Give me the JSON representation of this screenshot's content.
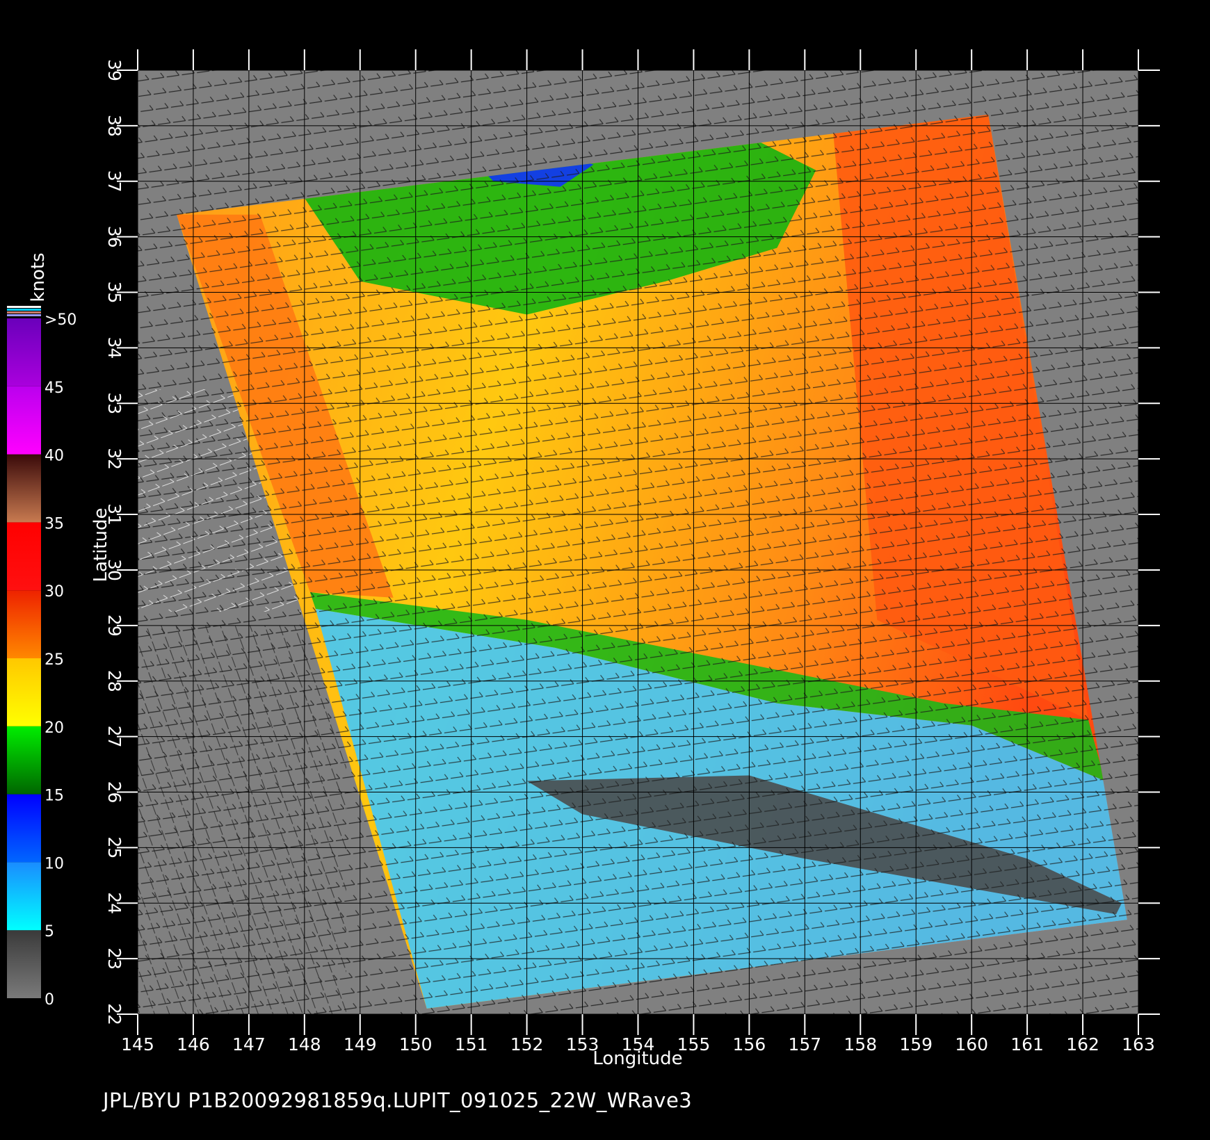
{
  "footer": "JPL/BYU  P1B20092981859q.LUPIT_091025_22W_WRave3",
  "chart_data": {
    "type": "heatmap",
    "title": "",
    "xlabel": "Longitude",
    "ylabel": "Latitude",
    "xlim": [
      145,
      163
    ],
    "ylim": [
      22,
      39
    ],
    "x_ticks": [
      "145",
      "146",
      "147",
      "148",
      "149",
      "150",
      "151",
      "152",
      "153",
      "154",
      "155",
      "156",
      "157",
      "158",
      "159",
      "160",
      "161",
      "162",
      "163"
    ],
    "y_ticks": [
      "22",
      "23",
      "24",
      "25",
      "26",
      "27",
      "28",
      "29",
      "30",
      "31",
      "32",
      "33",
      "34",
      "35",
      "36",
      "37",
      "38",
      "39"
    ],
    "grid": true,
    "colorbar": {
      "title": "knots",
      "labels": [
        "0",
        "5",
        "10",
        "15",
        "20",
        "25",
        "30",
        "35",
        "40",
        "45",
        ">50"
      ],
      "range": [
        0,
        50
      ],
      "stops": [
        {
          "from": 0,
          "to": 5,
          "top": "#3a3a3a",
          "bottom": "#7a7a7a"
        },
        {
          "from": 5,
          "to": 10,
          "top": "#1a8cff",
          "bottom": "#00ffff"
        },
        {
          "from": 10,
          "to": 15,
          "top": "#0000ff",
          "bottom": "#0066ff"
        },
        {
          "from": 15,
          "to": 20,
          "top": "#00ee00",
          "bottom": "#006600"
        },
        {
          "from": 20,
          "to": 25,
          "top": "#ffc800",
          "bottom": "#ffff00"
        },
        {
          "from": 25,
          "to": 30,
          "top": "#ee2200",
          "bottom": "#ff8800"
        },
        {
          "from": 30,
          "to": 35,
          "top": "#ff0000",
          "bottom": "#ff1010"
        },
        {
          "from": 35,
          "to": 40,
          "top": "#3a0a0a",
          "bottom": "#c87a50"
        },
        {
          "from": 40,
          "to": 45,
          "top": "#bb00ee",
          "bottom": "#ff00ff"
        },
        {
          "from": 45,
          "to": 50,
          "top": "#6a00bb",
          "bottom": "#aa00dd"
        }
      ]
    },
    "background_color": "#808080",
    "swath_corners_lonlat": [
      [
        145.7,
        36.4
      ],
      [
        160.3,
        38.2
      ],
      [
        162.8,
        23.7
      ],
      [
        150.2,
        22.1
      ]
    ],
    "wind_regions": [
      {
        "description": "strong band",
        "speed_knots": 28,
        "color": "#ff5a10",
        "polygon_lonlat": [
          [
            157.5,
            38.0
          ],
          [
            160.3,
            38.2
          ],
          [
            162.1,
            27.3
          ],
          [
            158.3,
            29.1
          ]
        ]
      },
      {
        "description": "northwest edge band",
        "speed_knots": 27,
        "color": "#ff7a12",
        "polygon_lonlat": [
          [
            145.7,
            36.4
          ],
          [
            147.2,
            36.4
          ],
          [
            149.6,
            29.5
          ],
          [
            148.1,
            29.6
          ]
        ]
      },
      {
        "description": "north light wind",
        "speed_knots": 18,
        "color": "#10b410",
        "polygon_lonlat": [
          [
            148.0,
            36.7
          ],
          [
            152.5,
            37.5
          ],
          [
            156.2,
            37.7
          ],
          [
            157.2,
            37.2
          ],
          [
            156.5,
            35.8
          ],
          [
            154.5,
            35.2
          ],
          [
            152.0,
            34.6
          ],
          [
            149.0,
            35.2
          ]
        ]
      },
      {
        "description": "calm north patch",
        "speed_knots": 13,
        "color": "#1030ff",
        "polygon_lonlat": [
          [
            151.0,
            37.4
          ],
          [
            152.3,
            37.6
          ],
          [
            153.2,
            37.3
          ],
          [
            152.6,
            36.9
          ],
          [
            151.4,
            37.0
          ]
        ]
      },
      {
        "description": "frontal boundary",
        "speed_knots": 17,
        "color": "#18b818",
        "polygon_lonlat": [
          [
            148.1,
            29.6
          ],
          [
            152.0,
            29.1
          ],
          [
            156.0,
            28.3
          ],
          [
            159.5,
            27.6
          ],
          [
            162.1,
            27.3
          ],
          [
            162.4,
            26.2
          ],
          [
            160.0,
            27.2
          ],
          [
            156.5,
            27.6
          ],
          [
            152.5,
            28.6
          ],
          [
            148.2,
            29.3
          ]
        ]
      },
      {
        "description": "south light wind",
        "speed_knots": 8,
        "color": "#3ec8ff",
        "polygon_lonlat": [
          [
            148.2,
            29.3
          ],
          [
            152.5,
            28.6
          ],
          [
            156.5,
            27.6
          ],
          [
            160.0,
            27.2
          ],
          [
            162.4,
            26.2
          ],
          [
            162.8,
            23.7
          ],
          [
            150.2,
            22.1
          ]
        ]
      },
      {
        "description": "calm patches",
        "speed_knots": 3,
        "color": "#4a4a4a",
        "polygon_lonlat": [
          [
            152.0,
            26.2
          ],
          [
            156.0,
            26.3
          ],
          [
            161.0,
            24.8
          ],
          [
            162.7,
            24.0
          ],
          [
            162.6,
            23.8
          ],
          [
            157.0,
            24.8
          ],
          [
            153.0,
            25.6
          ]
        ]
      }
    ]
  }
}
